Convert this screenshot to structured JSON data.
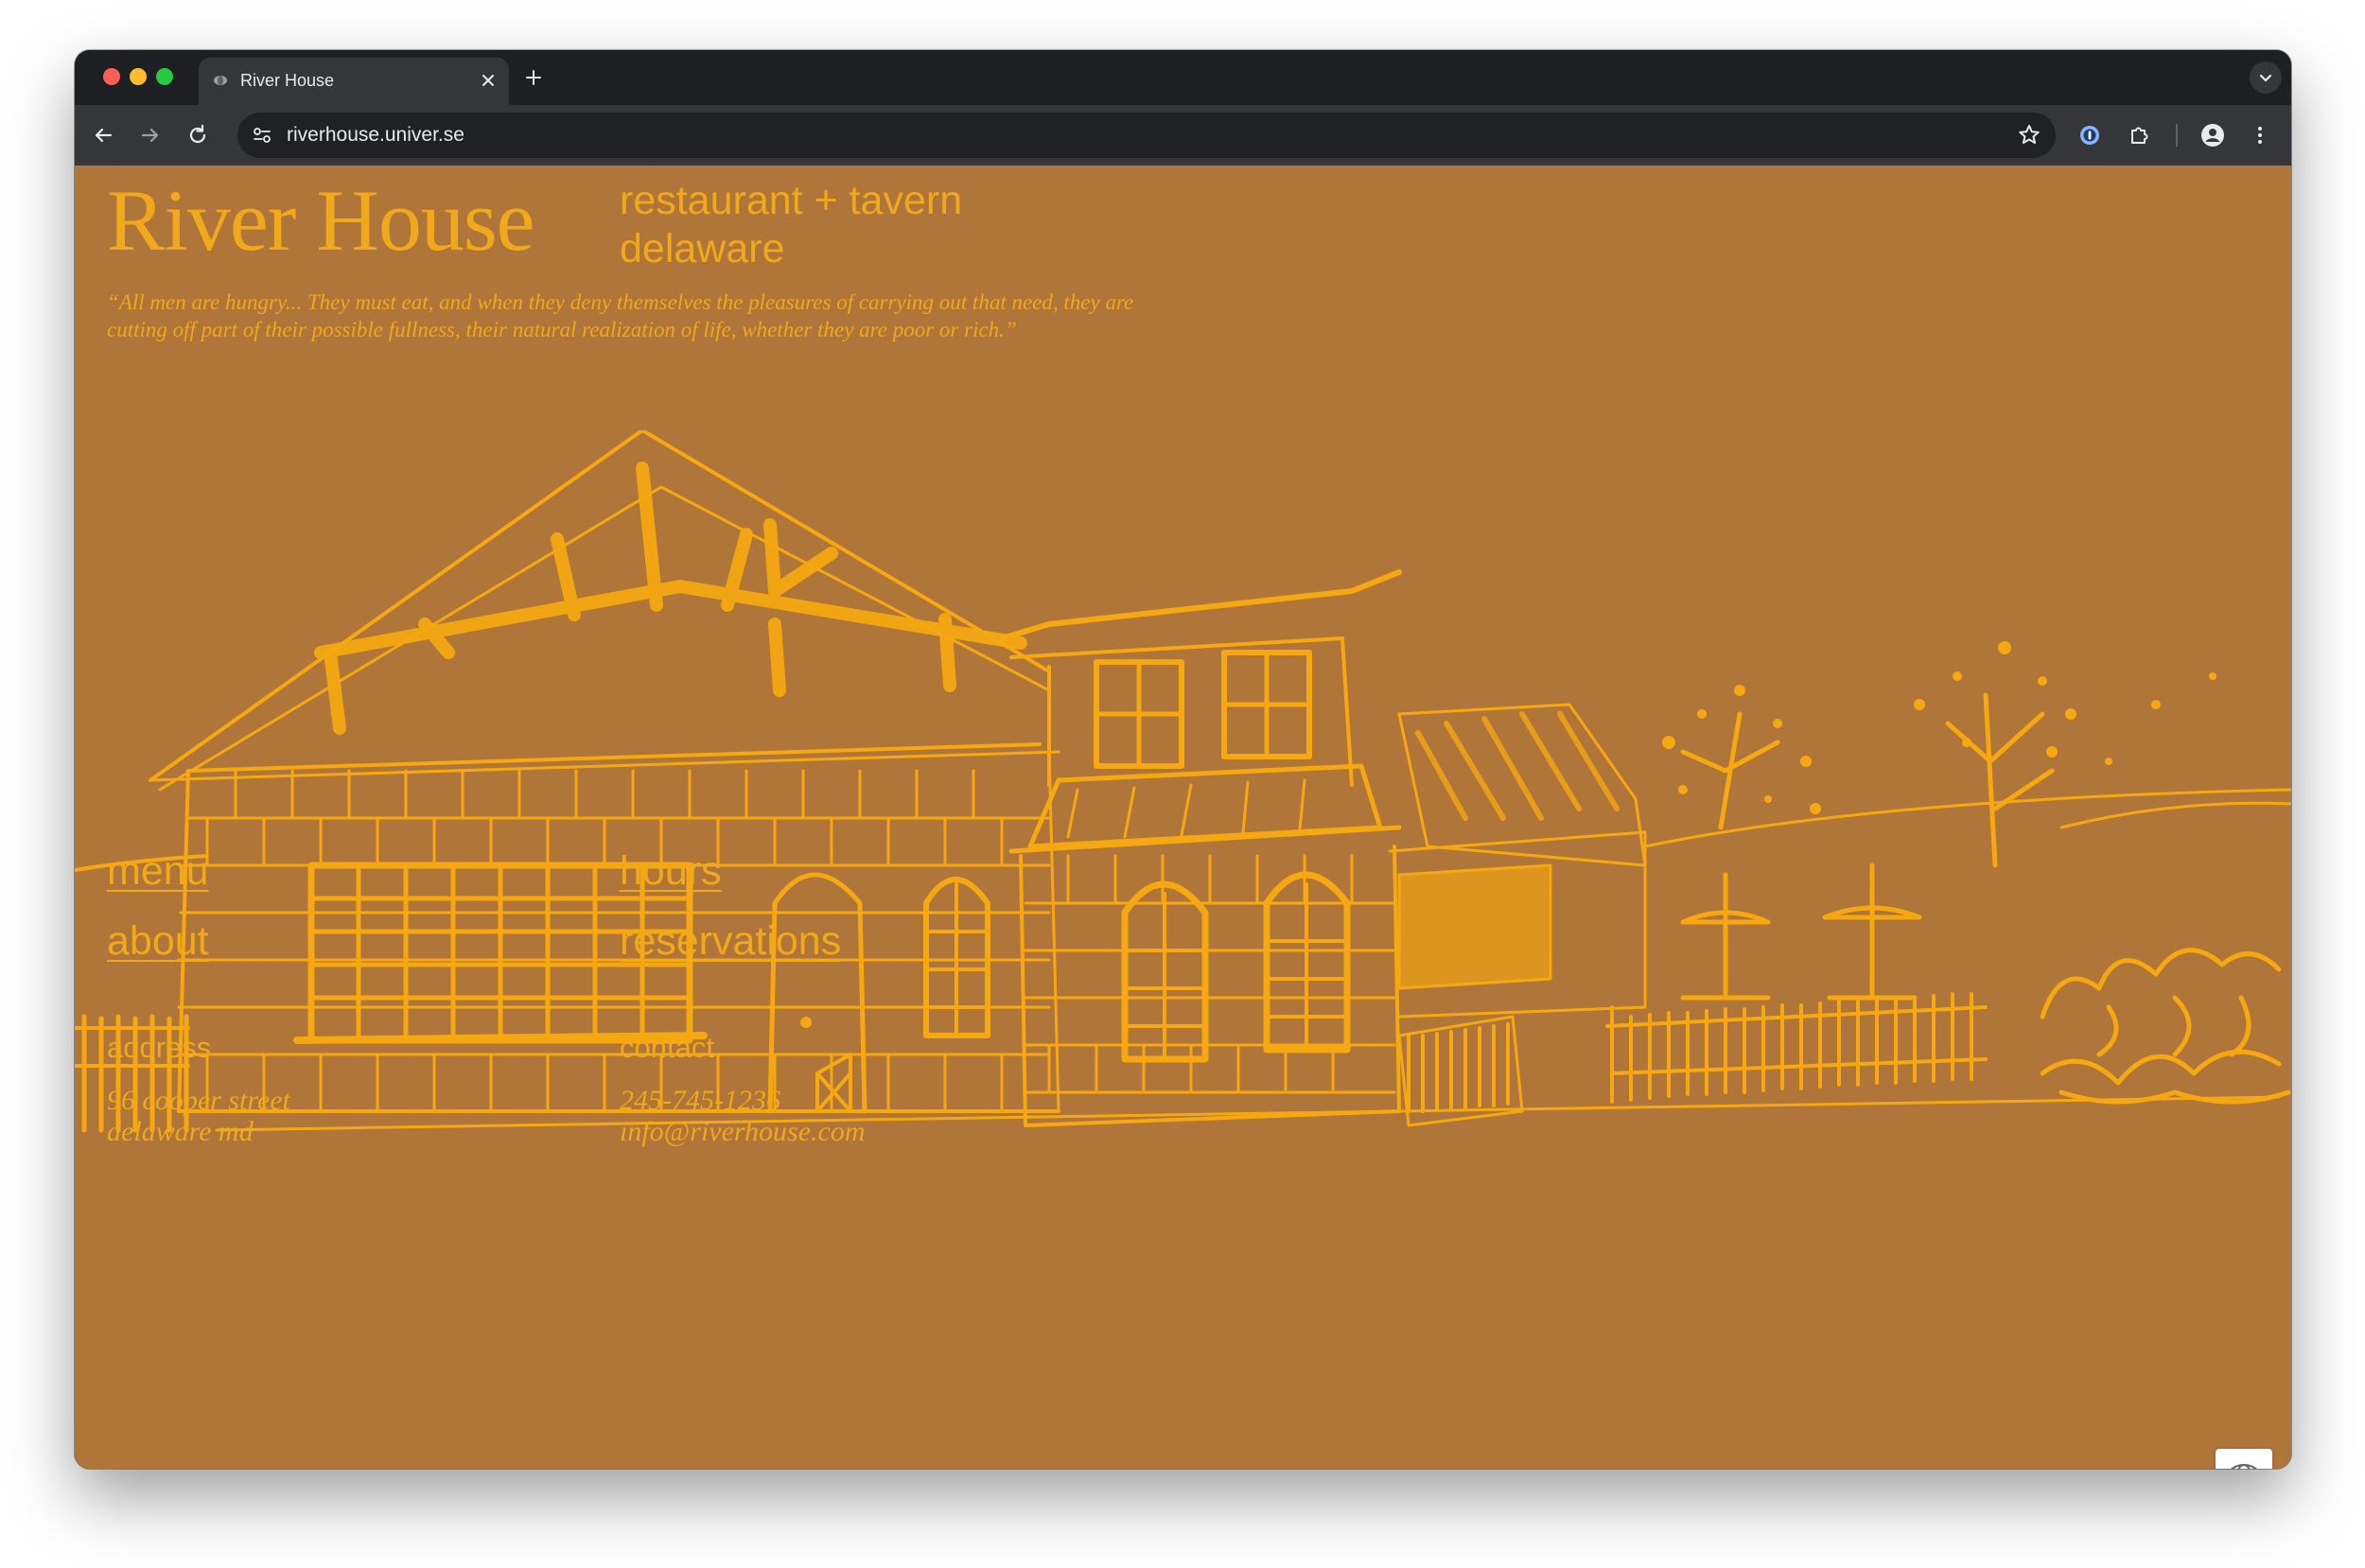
{
  "browser": {
    "tab_title": "River House",
    "url": "riverhouse.univer.se"
  },
  "site": {
    "brand": "River House",
    "tagline_line1": "restaurant + tavern",
    "tagline_line2": "delaware",
    "quote": "“All men are hungry... They must eat, and when they deny themselves the pleasures of carrying out that need, they are cutting off part of their possible fullness, their natural realization of life, whether they are poor or rich.”"
  },
  "nav": {
    "menu": "menu",
    "about": "about",
    "hours": "hours",
    "reservations": "reservations"
  },
  "footer": {
    "address_label": "address",
    "address_line1": "96 cooper street",
    "address_line2": "delaware md",
    "contact_label": "contact",
    "phone": "245-745-1236",
    "email": "info@riverhouse.com"
  },
  "icons": [
    "back-icon",
    "forward-icon",
    "reload-icon",
    "site-info-icon",
    "star-icon",
    "password-manager-icon",
    "extensions-icon",
    "profile-icon",
    "more-icon",
    "globe-icon"
  ],
  "colors": {
    "page_bg": "#b07538",
    "accent": "#f0a81c",
    "chrome_dark": "#1e1f22",
    "chrome_toolbar": "#35363a"
  }
}
